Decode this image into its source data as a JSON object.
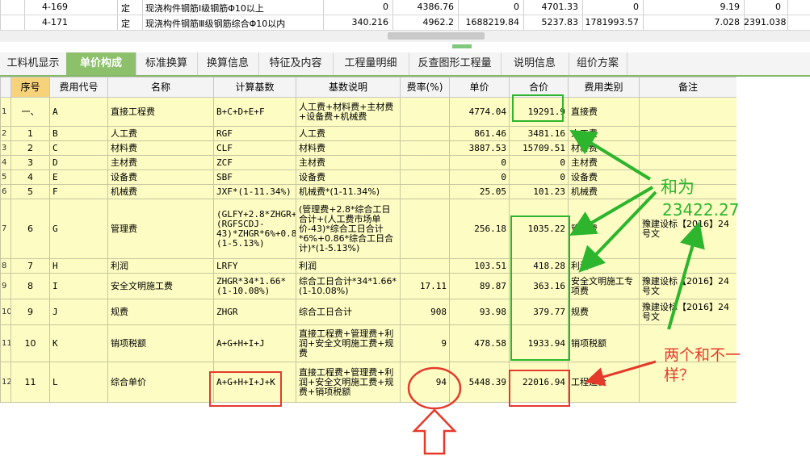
{
  "top_rows": [
    {
      "code": "4-169",
      "type": "定",
      "name": "现浇构件钢筋Ⅰ级钢筋Φ10以上",
      "v1": "0",
      "v2": "4386.76",
      "v3": "0",
      "v4": "4701.33",
      "v5": "0",
      "v6": "9.19",
      "v7": "0"
    },
    {
      "code": "4-171",
      "type": "定",
      "name": "现浇构件钢筋Ⅲ级钢筋综合Φ10以内",
      "v1": "340.216",
      "v2": "4962.2",
      "v3": "1688219.84",
      "v4": "5237.83",
      "v5": "1781993.57",
      "v6": "7.028",
      "v7": "2391.038"
    }
  ],
  "tabs": [
    "工料机显示",
    "单价构成",
    "标准换算",
    "换算信息",
    "特征及内容",
    "工程量明细",
    "反查图形工程量",
    "说明信息",
    "组价方案"
  ],
  "active_tab": 1,
  "table": {
    "headers": [
      "序号",
      "费用代号",
      "名称",
      "计算基数",
      "基数说明",
      "费率(%)",
      "单价",
      "合价",
      "费用类别",
      "备注"
    ],
    "rows": [
      {
        "rn": "1",
        "seq": "一、",
        "code": "A",
        "name": "直接工程费",
        "base": "B+C+D+E+F",
        "desc": "人工费+材料费+主材费+设备费+机械费",
        "rate": "",
        "price": "4774.04",
        "total": "19291.9",
        "cat": "直接费",
        "note": ""
      },
      {
        "rn": "2",
        "seq": "1",
        "code": "B",
        "name": "人工费",
        "base": "RGF",
        "desc": "人工费",
        "rate": "",
        "price": "861.46",
        "total": "3481.16",
        "cat": "人工费",
        "note": ""
      },
      {
        "rn": "3",
        "seq": "2",
        "code": "C",
        "name": "材料费",
        "base": "CLF",
        "desc": "材料费",
        "rate": "",
        "price": "3887.53",
        "total": "15709.51",
        "cat": "材料费",
        "note": ""
      },
      {
        "rn": "4",
        "seq": "3",
        "code": "D",
        "name": "主材费",
        "base": "ZCF",
        "desc": "主材费",
        "rate": "",
        "price": "0",
        "total": "0",
        "cat": "主材费",
        "note": ""
      },
      {
        "rn": "5",
        "seq": "4",
        "code": "E",
        "name": "设备费",
        "base": "SBF",
        "desc": "设备费",
        "rate": "",
        "price": "0",
        "total": "0",
        "cat": "设备费",
        "note": ""
      },
      {
        "rn": "6",
        "seq": "5",
        "code": "F",
        "name": "机械费",
        "base": "JXF*(1-11.34%)",
        "desc": "机械费*(1-11.34%)",
        "rate": "",
        "price": "25.05",
        "total": "101.23",
        "cat": "机械费",
        "note": ""
      },
      {
        "rn": "7",
        "seq": "6",
        "code": "G",
        "name": "管理费",
        "base": "(GLFY+2.8*ZHGR+(RGFSCDJ-43)*ZHGR*6%+0.86*ZHGR)*(1-5.13%)",
        "desc": "(管理费+2.8*综合工日合计+(人工费市场单价-43)*综合工日合计*6%+0.86*综合工日合计)*(1-5.13%)",
        "rate": "",
        "price": "256.18",
        "total": "1035.22",
        "cat": "管理费",
        "note": "豫建设标【2016】24号文"
      },
      {
        "rn": "8",
        "seq": "7",
        "code": "H",
        "name": "利润",
        "base": "LRFY",
        "desc": "利润",
        "rate": "",
        "price": "103.51",
        "total": "418.28",
        "cat": "利润",
        "note": ""
      },
      {
        "rn": "9",
        "seq": "8",
        "code": "I",
        "name": "安全文明施工费",
        "base": "ZHGR*34*1.66*(1-10.08%)",
        "desc": "综合工日合计*34*1.66*(1-10.08%)",
        "rate": "17.11",
        "price": "89.87",
        "total": "363.16",
        "cat": "安全文明施工专项费",
        "note": "豫建设标【2016】24号文"
      },
      {
        "rn": "10",
        "seq": "9",
        "code": "J",
        "name": "规费",
        "base": "ZHGR",
        "desc": "综合工日合计",
        "rate": "908",
        "price": "93.98",
        "total": "379.77",
        "cat": "规费",
        "note": "豫建设标【2016】24号文"
      },
      {
        "rn": "11",
        "seq": "10",
        "code": "K",
        "name": "销项税额",
        "base": "A+G+H+I+J",
        "desc": "直接工程费+管理费+利润+安全文明施工费+规费",
        "rate": "9",
        "price": "478.58",
        "total": "1933.94",
        "cat": "销项税额",
        "note": ""
      },
      {
        "rn": "12",
        "seq": "11",
        "code": "L",
        "name": "综合单价",
        "base": "A+G+H+I+J+K",
        "desc": "直接工程费+管理费+利润+安全文明施工费+规费+销项税额",
        "rate": "94",
        "price": "5448.39",
        "total": "22016.94",
        "cat": "工程造价",
        "note": ""
      }
    ]
  },
  "annotations": {
    "sum_label": "和为",
    "sum_value": "23422.27",
    "question": "两个和不一样？",
    "green_color": "#2db52d",
    "red_color": "#e53a2b"
  }
}
